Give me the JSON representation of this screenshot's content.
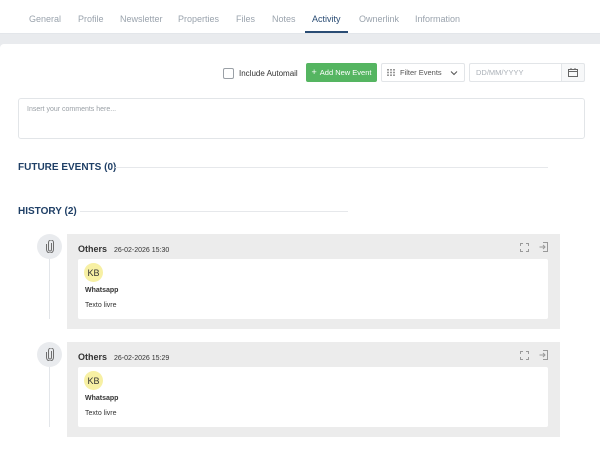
{
  "tabs": [
    {
      "label": "General"
    },
    {
      "label": "Profile"
    },
    {
      "label": "Newsletter"
    },
    {
      "label": "Properties"
    },
    {
      "label": "Files"
    },
    {
      "label": "Notes"
    },
    {
      "label": "Activity"
    },
    {
      "label": "Ownerlink"
    },
    {
      "label": "Information"
    }
  ],
  "active_tab": "Activity",
  "toolbar": {
    "include_automail_label": "Include Automail",
    "include_automail_checked": false,
    "add_event_label": "Add New Event",
    "add_event_icon": "plus-icon",
    "filter_label": "Filter Events",
    "filter_icon": "grid-icon",
    "date_placeholder": "DD/MM/YYYY",
    "calendar_icon": "calendar-icon"
  },
  "comments": {
    "placeholder": "Insert your comments here..."
  },
  "future_events": {
    "title": "FUTURE EVENTS (0)"
  },
  "history": {
    "title": "HISTORY (2)",
    "events": [
      {
        "type": "Others",
        "timestamp": "26-02-2026 15:30",
        "avatar_initials": "KB",
        "channel": "Whatsapp",
        "text": "Texto livre"
      },
      {
        "type": "Others",
        "timestamp": "26-02-2026 15:29",
        "avatar_initials": "KB",
        "channel": "Whatsapp",
        "text": "Texto livre"
      }
    ]
  },
  "colors": {
    "accent": "#2a4c74",
    "add_button": "#55b561",
    "avatar_bg": "#f7f0a4"
  }
}
